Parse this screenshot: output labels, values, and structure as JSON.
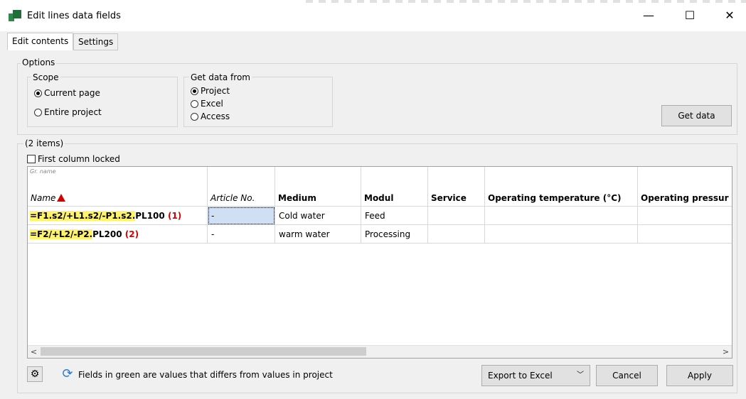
{
  "window": {
    "title": "Edit lines data fields",
    "minimize": "—",
    "maximize": "☐",
    "close": "✕"
  },
  "tabs": [
    {
      "label": "Edit contents",
      "active": true
    },
    {
      "label": "Settings",
      "active": false
    }
  ],
  "options": {
    "group_label": "Options",
    "scope": {
      "label": "Scope",
      "items": [
        {
          "label": "Current page",
          "checked": true
        },
        {
          "label": "Entire project",
          "checked": false
        }
      ]
    },
    "get_data_from": {
      "label": "Get data from",
      "items": [
        {
          "label": "Project",
          "checked": true
        },
        {
          "label": "Excel",
          "checked": false
        },
        {
          "label": "Access",
          "checked": false
        }
      ]
    },
    "get_data_button": "Get data"
  },
  "items": {
    "group_label": "(2 items)",
    "first_column_locked": {
      "label": "First column locked",
      "checked": false
    }
  },
  "grid": {
    "group_header": "Gr. name",
    "columns": [
      {
        "label": "Name",
        "style": "italic"
      },
      {
        "label": "Article No.",
        "style": "italic"
      },
      {
        "label": "Medium",
        "style": "bold"
      },
      {
        "label": "Modul",
        "style": "bold"
      },
      {
        "label": "Service",
        "style": "bold"
      },
      {
        "label": "Operating temperature (°C)",
        "style": "bold"
      },
      {
        "label": "Operating pressur",
        "style": "bold"
      }
    ],
    "rows": [
      {
        "name_prefix": "=F1.s2/+L1.s2/-P1.s2.",
        "name_suffix": "PL100",
        "count": "(1)",
        "article": "-",
        "medium": "Cold water",
        "modul": "Feed",
        "service": "",
        "temperature": "",
        "pressure": ""
      },
      {
        "name_prefix": "=F2/+L2/-P2.",
        "name_suffix": "PL200",
        "count": "(2)",
        "article": "-",
        "medium": "warm water",
        "modul": "Processing",
        "service": "",
        "temperature": "",
        "pressure": ""
      }
    ],
    "scroll_left": "<",
    "scroll_right": ">"
  },
  "footer": {
    "hint": "Fields in green are values that differs from values in project",
    "export_select": "Export to Excel",
    "cancel": "Cancel",
    "apply": "Apply"
  },
  "colors": {
    "highlight": "#fff36b",
    "count_red": "#d40000",
    "selection": "#cfe0f5"
  }
}
